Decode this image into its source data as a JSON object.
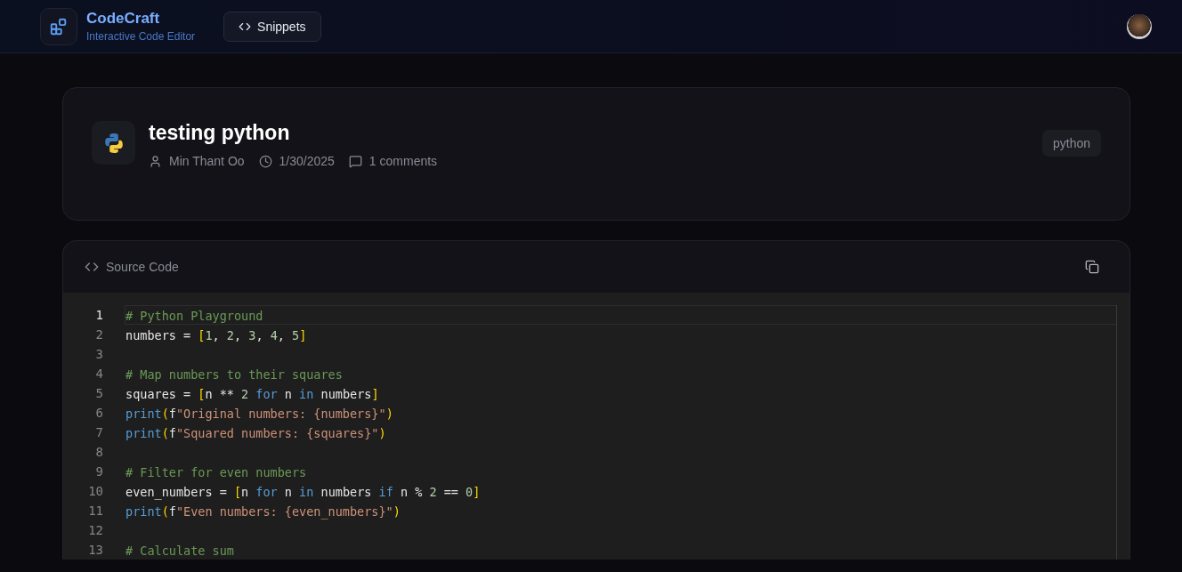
{
  "header": {
    "brand": "CodeCraft",
    "tagline": "Interactive Code Editor",
    "nav": [
      {
        "label": "Snippets",
        "selected": false
      }
    ]
  },
  "snippet": {
    "title": "testing python",
    "author": "Min Thant Oo",
    "date": "1/30/2025",
    "comments": "1 comments",
    "language": "python"
  },
  "source": {
    "title": "Source Code",
    "lines": [
      {
        "number": "1",
        "active": true,
        "tokens": [
          {
            "kind": "comment",
            "text": "# Python Playground"
          }
        ]
      },
      {
        "number": "2",
        "active": false,
        "tokens": [
          {
            "kind": "plain",
            "text": "numbers = "
          },
          {
            "kind": "bracket",
            "text": "["
          },
          {
            "kind": "number",
            "text": "1"
          },
          {
            "kind": "plain",
            "text": ", "
          },
          {
            "kind": "number",
            "text": "2"
          },
          {
            "kind": "plain",
            "text": ", "
          },
          {
            "kind": "number",
            "text": "3"
          },
          {
            "kind": "plain",
            "text": ", "
          },
          {
            "kind": "number",
            "text": "4"
          },
          {
            "kind": "plain",
            "text": ", "
          },
          {
            "kind": "number",
            "text": "5"
          },
          {
            "kind": "bracket",
            "text": "]"
          }
        ]
      },
      {
        "number": "3",
        "active": false
      },
      {
        "number": "4",
        "active": false,
        "tokens": [
          {
            "kind": "comment",
            "text": "# Map numbers to their squares"
          }
        ]
      },
      {
        "number": "5",
        "active": false,
        "tokens": [
          {
            "kind": "plain",
            "text": "squares = "
          },
          {
            "kind": "bracket",
            "text": "["
          },
          {
            "kind": "plain",
            "text": "n ** "
          },
          {
            "kind": "number",
            "text": "2"
          },
          {
            "kind": "keyword",
            "text": " for"
          },
          {
            "kind": "plain",
            "text": " n "
          },
          {
            "kind": "keyword",
            "text": "in"
          },
          {
            "kind": "plain",
            "text": " numbers"
          },
          {
            "kind": "bracket",
            "text": "]"
          }
        ]
      },
      {
        "number": "6",
        "active": false,
        "tokens": [
          {
            "kind": "keyword",
            "text": "print"
          },
          {
            "kind": "bracket",
            "text": "("
          },
          {
            "kind": "plain",
            "text": "f"
          },
          {
            "kind": "string",
            "text": "\"Original numbers: {numbers}\""
          },
          {
            "kind": "bracket",
            "text": ")"
          }
        ]
      },
      {
        "number": "7",
        "active": false,
        "tokens": [
          {
            "kind": "keyword",
            "text": "print"
          },
          {
            "kind": "bracket",
            "text": "("
          },
          {
            "kind": "plain",
            "text": "f"
          },
          {
            "kind": "string",
            "text": "\"Squared numbers: {squares}\""
          },
          {
            "kind": "bracket",
            "text": ")"
          }
        ]
      },
      {
        "number": "8",
        "active": false
      },
      {
        "number": "9",
        "active": false,
        "tokens": [
          {
            "kind": "comment",
            "text": "# Filter for even numbers"
          }
        ]
      },
      {
        "number": "10",
        "active": false,
        "tokens": [
          {
            "kind": "plain",
            "text": "even_numbers = "
          },
          {
            "kind": "bracket",
            "text": "["
          },
          {
            "kind": "plain",
            "text": "n "
          },
          {
            "kind": "keyword",
            "text": "for"
          },
          {
            "kind": "plain",
            "text": " n "
          },
          {
            "kind": "keyword",
            "text": "in"
          },
          {
            "kind": "plain",
            "text": " numbers "
          },
          {
            "kind": "keyword",
            "text": "if"
          },
          {
            "kind": "plain",
            "text": " n % "
          },
          {
            "kind": "number",
            "text": "2"
          },
          {
            "kind": "plain",
            "text": " == "
          },
          {
            "kind": "number",
            "text": "0"
          },
          {
            "kind": "bracket",
            "text": "]"
          }
        ]
      },
      {
        "number": "11",
        "active": false,
        "tokens": [
          {
            "kind": "keyword",
            "text": "print"
          },
          {
            "kind": "bracket",
            "text": "("
          },
          {
            "kind": "plain",
            "text": "f"
          },
          {
            "kind": "string",
            "text": "\"Even numbers: {even_numbers}\""
          },
          {
            "kind": "bracket",
            "text": ")"
          }
        ]
      },
      {
        "number": "12",
        "active": false
      },
      {
        "number": "13",
        "active": false,
        "tokens": [
          {
            "kind": "comment",
            "text": "# Calculate sum"
          }
        ]
      }
    ]
  }
}
